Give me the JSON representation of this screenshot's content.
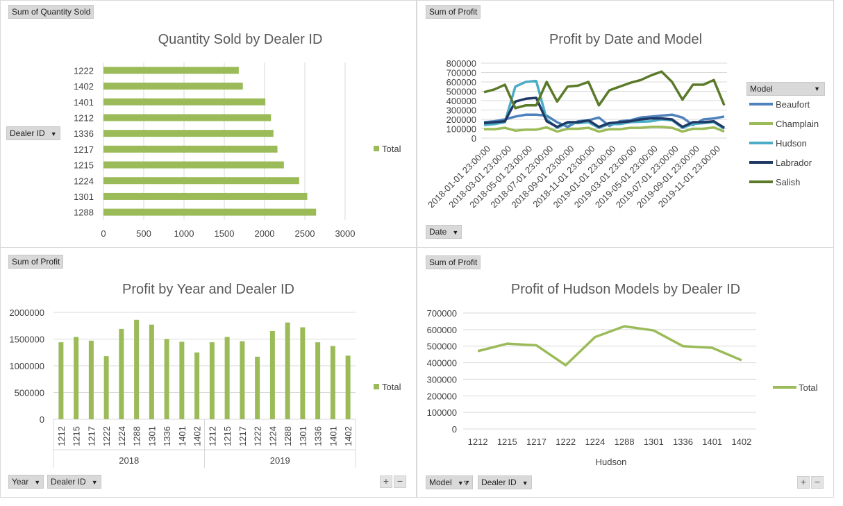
{
  "colors": {
    "green": "#9bbb59",
    "beaufort": "#4f81bd",
    "champlain": "#9bbb59",
    "hudson": "#4bacc6",
    "labrador": "#1f3864",
    "salish": "#5a7a2a",
    "grid": "#d9d9d9"
  },
  "panel1": {
    "value_button": "Sum of Quantity Sold",
    "axis_button": "Dealer ID",
    "zoom_plus": "+",
    "zoom_minus": "−"
  },
  "panel2": {
    "value_button": "Sum of Profit",
    "axis_button": "Date",
    "legend_button": "Model"
  },
  "panel3": {
    "value_button": "Sum of Profit",
    "axis_button_1": "Year",
    "axis_button_2": "Dealer ID",
    "zoom_plus": "+",
    "zoom_minus": "−"
  },
  "panel4": {
    "value_button": "Sum of Profit",
    "axis_button_1": "Model",
    "axis_button_2": "Dealer ID",
    "zoom_plus": "+",
    "zoom_minus": "−"
  },
  "chart_data": [
    {
      "type": "bar",
      "orientation": "horizontal",
      "title": "Quantity Sold by Dealer ID",
      "categories": [
        "1222",
        "1402",
        "1401",
        "1212",
        "1336",
        "1217",
        "1215",
        "1224",
        "1301",
        "1288"
      ],
      "series": [
        {
          "name": "Total",
          "values": [
            1680,
            1730,
            2010,
            2080,
            2110,
            2160,
            2240,
            2430,
            2530,
            2640
          ]
        }
      ],
      "xlim": [
        0,
        3000
      ],
      "xticks": [
        "0",
        "500",
        "1000",
        "1500",
        "2000",
        "2500",
        "3000"
      ],
      "legend": "right",
      "grid": true
    },
    {
      "type": "line",
      "title": "Profit by Date and Model",
      "x": [
        "2018-01-01 23:00:00",
        "2018-02-01 23:00:00",
        "2018-03-01 23:00:00",
        "2018-04-01 23:00:00",
        "2018-05-01 23:00:00",
        "2018-06-01 23:00:00",
        "2018-07-01 23:00:00",
        "2018-08-01 23:00:00",
        "2018-09-01 23:00:00",
        "2018-10-01 23:00:00",
        "2018-11-01 23:00:00",
        "2018-12-01 23:00:00",
        "2019-01-01 23:00:00",
        "2019-02-01 23:00:00",
        "2019-03-01 23:00:00",
        "2019-04-01 23:00:00",
        "2019-05-01 23:00:00",
        "2019-06-01 23:00:00",
        "2019-07-01 23:00:00",
        "2019-08-01 23:00:00",
        "2019-09-01 23:00:00",
        "2019-10-01 23:00:00",
        "2019-11-01 23:00:00",
        "2019-12-01 23:00:00"
      ],
      "xtick_labels": [
        "2018-01-01 23:00:00",
        "2018-03-01 23:00:00",
        "2018-05-01 23:00:00",
        "2018-07-01 23:00:00",
        "2018-09-01 23:00:00",
        "2018-11-01 23:00:00",
        "2019-01-01 23:00:00",
        "2019-03-01 23:00:00",
        "2019-05-01 23:00:00",
        "2019-07-01 23:00:00",
        "2019-09-01 23:00:00",
        "2019-11-01 23:00:00"
      ],
      "series": [
        {
          "name": "Beaufort",
          "values": [
            170000,
            180000,
            200000,
            230000,
            250000,
            250000,
            240000,
            170000,
            120000,
            180000,
            190000,
            220000,
            130000,
            180000,
            190000,
            220000,
            230000,
            240000,
            250000,
            220000,
            140000,
            200000,
            210000,
            230000
          ]
        },
        {
          "name": "Champlain",
          "values": [
            95000,
            95000,
            110000,
            80000,
            90000,
            90000,
            115000,
            70000,
            100000,
            100000,
            110000,
            70000,
            95000,
            95000,
            110000,
            110000,
            120000,
            120000,
            110000,
            70000,
            100000,
            100000,
            115000,
            70000
          ]
        },
        {
          "name": "Hudson",
          "values": [
            140000,
            150000,
            170000,
            550000,
            600000,
            610000,
            200000,
            110000,
            160000,
            160000,
            170000,
            110000,
            150000,
            150000,
            170000,
            175000,
            180000,
            200000,
            190000,
            110000,
            150000,
            160000,
            170000,
            100000
          ]
        },
        {
          "name": "Labrador",
          "values": [
            160000,
            170000,
            180000,
            390000,
            420000,
            430000,
            180000,
            120000,
            170000,
            170000,
            190000,
            120000,
            160000,
            170000,
            180000,
            200000,
            210000,
            210000,
            200000,
            120000,
            170000,
            170000,
            180000,
            110000
          ]
        },
        {
          "name": "Salish",
          "values": [
            490000,
            520000,
            570000,
            320000,
            350000,
            350000,
            600000,
            390000,
            550000,
            560000,
            600000,
            350000,
            510000,
            550000,
            590000,
            620000,
            670000,
            710000,
            600000,
            410000,
            570000,
            570000,
            620000,
            350000
          ]
        }
      ],
      "ylim": [
        0,
        800000
      ],
      "yticks": [
        "0",
        "100000",
        "200000",
        "300000",
        "400000",
        "500000",
        "600000",
        "700000",
        "800000"
      ],
      "legend": "right",
      "grid": true
    },
    {
      "type": "bar",
      "title": "Profit by Year and Dealer ID",
      "groups": [
        {
          "name": "2018",
          "categories": [
            "1212",
            "1215",
            "1217",
            "1222",
            "1224",
            "1288",
            "1301",
            "1336",
            "1401",
            "1402"
          ],
          "values": [
            1440000,
            1540000,
            1470000,
            1180000,
            1690000,
            1860000,
            1770000,
            1500000,
            1450000,
            1250000
          ]
        },
        {
          "name": "2019",
          "categories": [
            "1212",
            "1215",
            "1217",
            "1222",
            "1224",
            "1288",
            "1301",
            "1336",
            "1401",
            "1402"
          ],
          "values": [
            1440000,
            1540000,
            1460000,
            1170000,
            1650000,
            1810000,
            1720000,
            1440000,
            1370000,
            1190000
          ]
        }
      ],
      "series_name": "Total",
      "ylim": [
        0,
        2000000
      ],
      "yticks": [
        "0",
        "500000",
        "1000000",
        "1500000",
        "2000000"
      ],
      "legend": "right",
      "grid": true
    },
    {
      "type": "line",
      "title": "Profit of Hudson Models by Dealer ID",
      "categories": [
        "1212",
        "1215",
        "1217",
        "1222",
        "1224",
        "1288",
        "1301",
        "1336",
        "1401",
        "1402"
      ],
      "group_label": "Hudson",
      "series": [
        {
          "name": "Total",
          "values": [
            470000,
            515000,
            505000,
            385000,
            555000,
            620000,
            595000,
            500000,
            490000,
            415000
          ]
        }
      ],
      "ylim": [
        0,
        700000
      ],
      "yticks": [
        "0",
        "100000",
        "200000",
        "300000",
        "400000",
        "500000",
        "600000",
        "700000"
      ],
      "legend": "right",
      "grid": true
    }
  ]
}
